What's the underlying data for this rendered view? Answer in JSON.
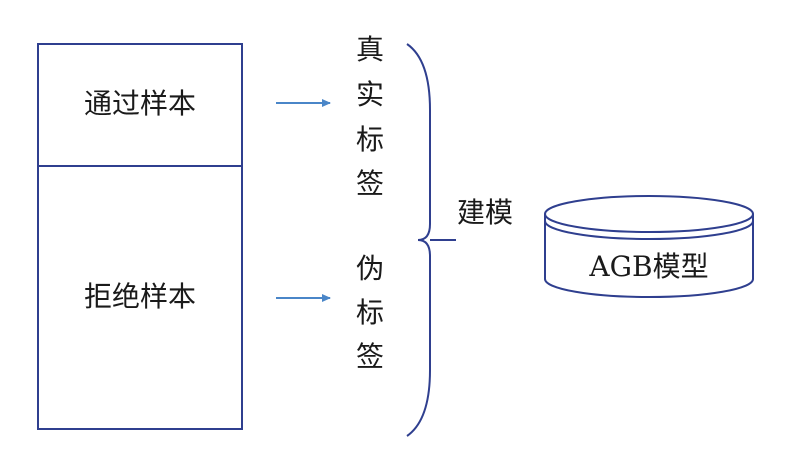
{
  "samples": {
    "pass": "通过样本",
    "reject": "拒绝样本"
  },
  "labels": {
    "true_label": [
      "真",
      "实",
      "标",
      "签"
    ],
    "pseudo_label": [
      "伪",
      "标",
      "签"
    ]
  },
  "modeling": "建模",
  "model": "AGB模型",
  "colors": {
    "box_stroke": "#2f3f8f",
    "arrow": "#4a86c8",
    "brace": "#2f3f8f"
  }
}
